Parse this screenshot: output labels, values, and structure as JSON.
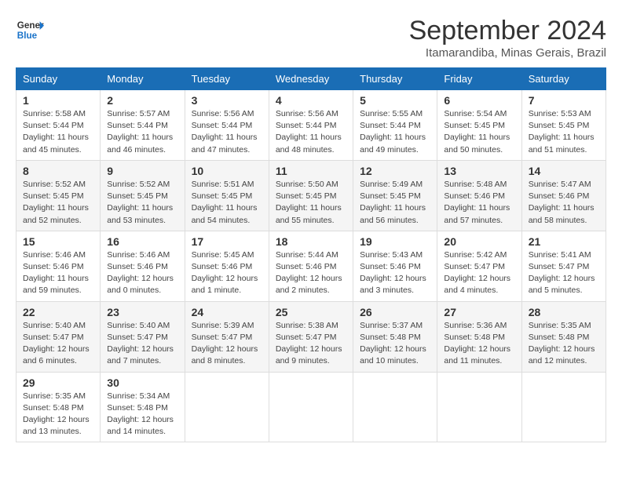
{
  "header": {
    "logo_line1": "General",
    "logo_line2": "Blue",
    "month": "September 2024",
    "location": "Itamarandiba, Minas Gerais, Brazil"
  },
  "weekdays": [
    "Sunday",
    "Monday",
    "Tuesday",
    "Wednesday",
    "Thursday",
    "Friday",
    "Saturday"
  ],
  "weeks": [
    [
      {
        "day": "1",
        "info": "Sunrise: 5:58 AM\nSunset: 5:44 PM\nDaylight: 11 hours\nand 45 minutes."
      },
      {
        "day": "2",
        "info": "Sunrise: 5:57 AM\nSunset: 5:44 PM\nDaylight: 11 hours\nand 46 minutes."
      },
      {
        "day": "3",
        "info": "Sunrise: 5:56 AM\nSunset: 5:44 PM\nDaylight: 11 hours\nand 47 minutes."
      },
      {
        "day": "4",
        "info": "Sunrise: 5:56 AM\nSunset: 5:44 PM\nDaylight: 11 hours\nand 48 minutes."
      },
      {
        "day": "5",
        "info": "Sunrise: 5:55 AM\nSunset: 5:44 PM\nDaylight: 11 hours\nand 49 minutes."
      },
      {
        "day": "6",
        "info": "Sunrise: 5:54 AM\nSunset: 5:45 PM\nDaylight: 11 hours\nand 50 minutes."
      },
      {
        "day": "7",
        "info": "Sunrise: 5:53 AM\nSunset: 5:45 PM\nDaylight: 11 hours\nand 51 minutes."
      }
    ],
    [
      {
        "day": "8",
        "info": "Sunrise: 5:52 AM\nSunset: 5:45 PM\nDaylight: 11 hours\nand 52 minutes."
      },
      {
        "day": "9",
        "info": "Sunrise: 5:52 AM\nSunset: 5:45 PM\nDaylight: 11 hours\nand 53 minutes."
      },
      {
        "day": "10",
        "info": "Sunrise: 5:51 AM\nSunset: 5:45 PM\nDaylight: 11 hours\nand 54 minutes."
      },
      {
        "day": "11",
        "info": "Sunrise: 5:50 AM\nSunset: 5:45 PM\nDaylight: 11 hours\nand 55 minutes."
      },
      {
        "day": "12",
        "info": "Sunrise: 5:49 AM\nSunset: 5:45 PM\nDaylight: 11 hours\nand 56 minutes."
      },
      {
        "day": "13",
        "info": "Sunrise: 5:48 AM\nSunset: 5:46 PM\nDaylight: 11 hours\nand 57 minutes."
      },
      {
        "day": "14",
        "info": "Sunrise: 5:47 AM\nSunset: 5:46 PM\nDaylight: 11 hours\nand 58 minutes."
      }
    ],
    [
      {
        "day": "15",
        "info": "Sunrise: 5:46 AM\nSunset: 5:46 PM\nDaylight: 11 hours\nand 59 minutes."
      },
      {
        "day": "16",
        "info": "Sunrise: 5:46 AM\nSunset: 5:46 PM\nDaylight: 12 hours\nand 0 minutes."
      },
      {
        "day": "17",
        "info": "Sunrise: 5:45 AM\nSunset: 5:46 PM\nDaylight: 12 hours\nand 1 minute."
      },
      {
        "day": "18",
        "info": "Sunrise: 5:44 AM\nSunset: 5:46 PM\nDaylight: 12 hours\nand 2 minutes."
      },
      {
        "day": "19",
        "info": "Sunrise: 5:43 AM\nSunset: 5:46 PM\nDaylight: 12 hours\nand 3 minutes."
      },
      {
        "day": "20",
        "info": "Sunrise: 5:42 AM\nSunset: 5:47 PM\nDaylight: 12 hours\nand 4 minutes."
      },
      {
        "day": "21",
        "info": "Sunrise: 5:41 AM\nSunset: 5:47 PM\nDaylight: 12 hours\nand 5 minutes."
      }
    ],
    [
      {
        "day": "22",
        "info": "Sunrise: 5:40 AM\nSunset: 5:47 PM\nDaylight: 12 hours\nand 6 minutes."
      },
      {
        "day": "23",
        "info": "Sunrise: 5:40 AM\nSunset: 5:47 PM\nDaylight: 12 hours\nand 7 minutes."
      },
      {
        "day": "24",
        "info": "Sunrise: 5:39 AM\nSunset: 5:47 PM\nDaylight: 12 hours\nand 8 minutes."
      },
      {
        "day": "25",
        "info": "Sunrise: 5:38 AM\nSunset: 5:47 PM\nDaylight: 12 hours\nand 9 minutes."
      },
      {
        "day": "26",
        "info": "Sunrise: 5:37 AM\nSunset: 5:48 PM\nDaylight: 12 hours\nand 10 minutes."
      },
      {
        "day": "27",
        "info": "Sunrise: 5:36 AM\nSunset: 5:48 PM\nDaylight: 12 hours\nand 11 minutes."
      },
      {
        "day": "28",
        "info": "Sunrise: 5:35 AM\nSunset: 5:48 PM\nDaylight: 12 hours\nand 12 minutes."
      }
    ],
    [
      {
        "day": "29",
        "info": "Sunrise: 5:35 AM\nSunset: 5:48 PM\nDaylight: 12 hours\nand 13 minutes."
      },
      {
        "day": "30",
        "info": "Sunrise: 5:34 AM\nSunset: 5:48 PM\nDaylight: 12 hours\nand 14 minutes."
      },
      null,
      null,
      null,
      null,
      null
    ]
  ]
}
